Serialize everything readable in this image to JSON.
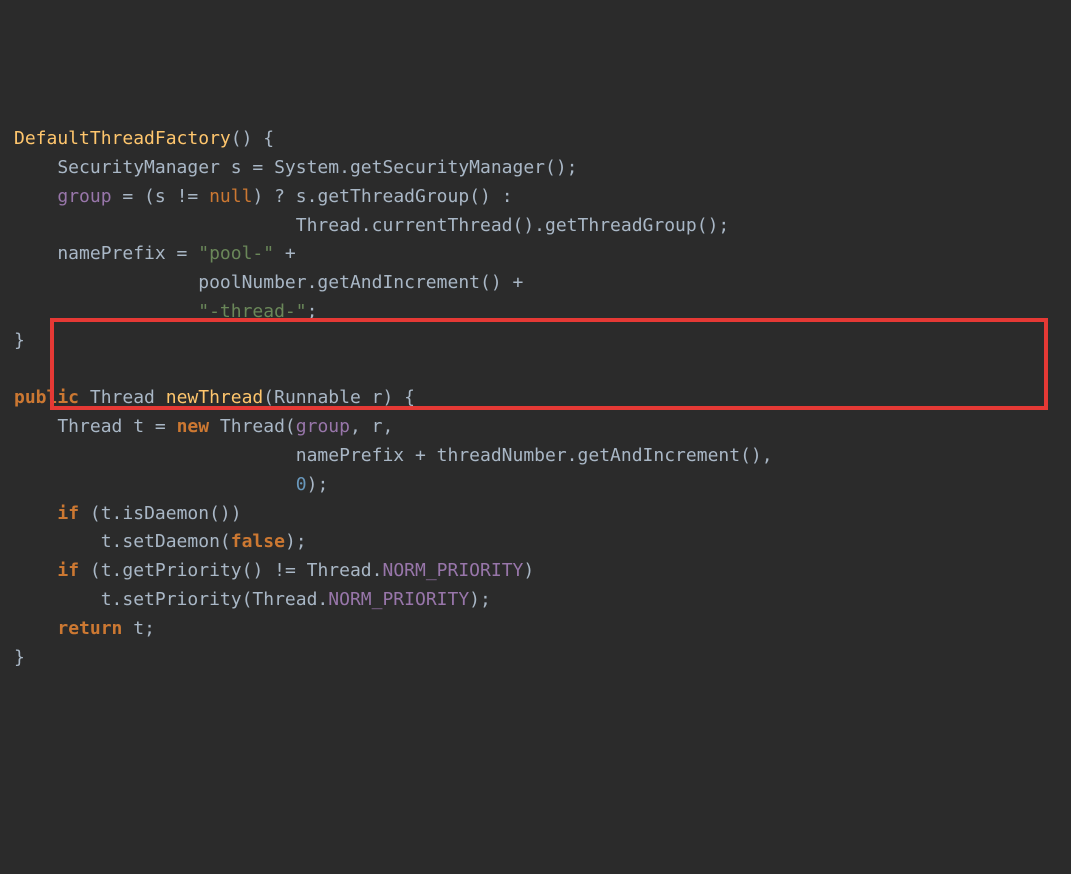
{
  "code": {
    "l1_a": "DefaultThreadFactory",
    "l1_b": "() {",
    "l2_a": "    SecurityManager s = System.getSecurityManager();",
    "l3_a": "    ",
    "l3_b": "group",
    "l3_c": " = (s != ",
    "l3_d": "null",
    "l3_e": ") ? s.getThreadGroup() :",
    "l4_a": "                          Thread.currentThread().getThreadGroup();",
    "l5_a": "    namePrefix = ",
    "l5_b": "\"pool-\"",
    "l5_c": " +",
    "l6_a": "                 poolNumber.getAndIncrement() +",
    "l7_a": "                 ",
    "l7_b": "\"-thread-\"",
    "l7_c": ";",
    "l8_a": "}",
    "l10_a": "public",
    "l10_b": " Thread ",
    "l10_c": "newThread",
    "l10_d": "(Runnable r) {",
    "l11_a": "    Thread t = ",
    "l11_b": "new",
    "l11_c": " Thread(",
    "l11_d": "group",
    "l11_e": ", r,",
    "l12_a": "                          namePrefix + threadNumber.getAndIncrement(),",
    "l13_a": "                          ",
    "l13_b": "0",
    "l13_c": ");",
    "l14_a": "    ",
    "l14_b": "if",
    "l14_c": " (t.isDaemon())",
    "l15_a": "        t.setDaemon(",
    "l15_b": "false",
    "l15_c": ");",
    "l16_a": "    ",
    "l16_b": "if",
    "l16_c": " (t.getPriority() != Thread.",
    "l16_d": "NORM_PRIORITY",
    "l16_e": ")",
    "l17_a": "        t.setPriority(Thread.",
    "l17_b": "NORM_PRIORITY",
    "l17_c": ");",
    "l18_a": "    ",
    "l18_b": "return",
    "l18_c": " t;",
    "l19_a": "}"
  }
}
